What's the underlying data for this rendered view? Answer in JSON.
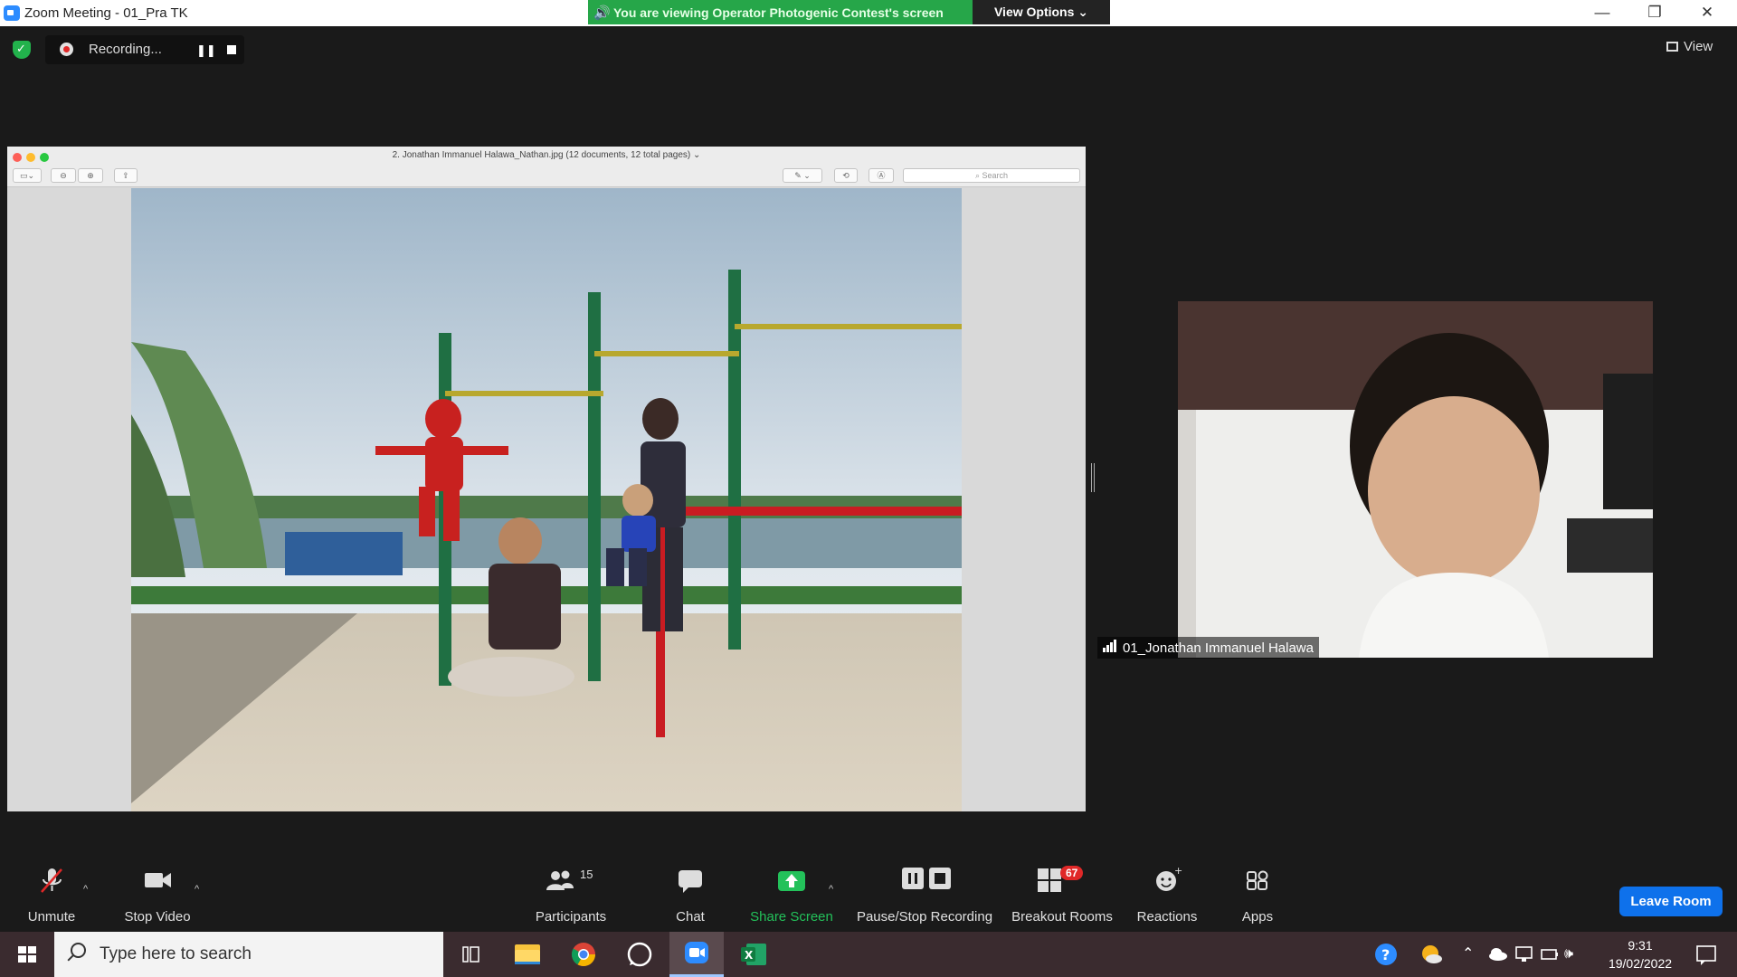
{
  "window": {
    "title": "Zoom Meeting - 01_Pra TK",
    "minimize": "—",
    "restore": "❐",
    "close": "✕"
  },
  "share_banner": {
    "text": "You are viewing Operator Photogenic Contest's screen",
    "view_options": "View Options ⌄"
  },
  "recording": {
    "label": "Recording...",
    "pause": "❚❚"
  },
  "view_button": "View",
  "shared_screen": {
    "document_title": "2. Jonathan Immanuel Halawa_Nathan.jpg (12 documents, 12 total pages) ⌄",
    "search_placeholder": "Search"
  },
  "participant": {
    "name": "01_Jonathan Immanuel Halawa"
  },
  "controls": {
    "unmute": "Unmute",
    "stop_video": "Stop Video",
    "participants": "Participants",
    "participant_count": "15",
    "chat": "Chat",
    "share_screen": "Share Screen",
    "pause_stop_recording": "Pause/Stop Recording",
    "breakout_rooms": "Breakout Rooms",
    "breakout_badge": "67",
    "reactions": "Reactions",
    "apps": "Apps",
    "leave": "Leave Room",
    "caret": "^"
  },
  "taskbar": {
    "search_placeholder": "Type here to search",
    "time": "9:31",
    "date": "19/02/2022"
  },
  "colors": {
    "banner_green": "#26a649",
    "share_green": "#23c15a",
    "leave_blue": "#0e71eb",
    "badge_red": "#e02828"
  }
}
